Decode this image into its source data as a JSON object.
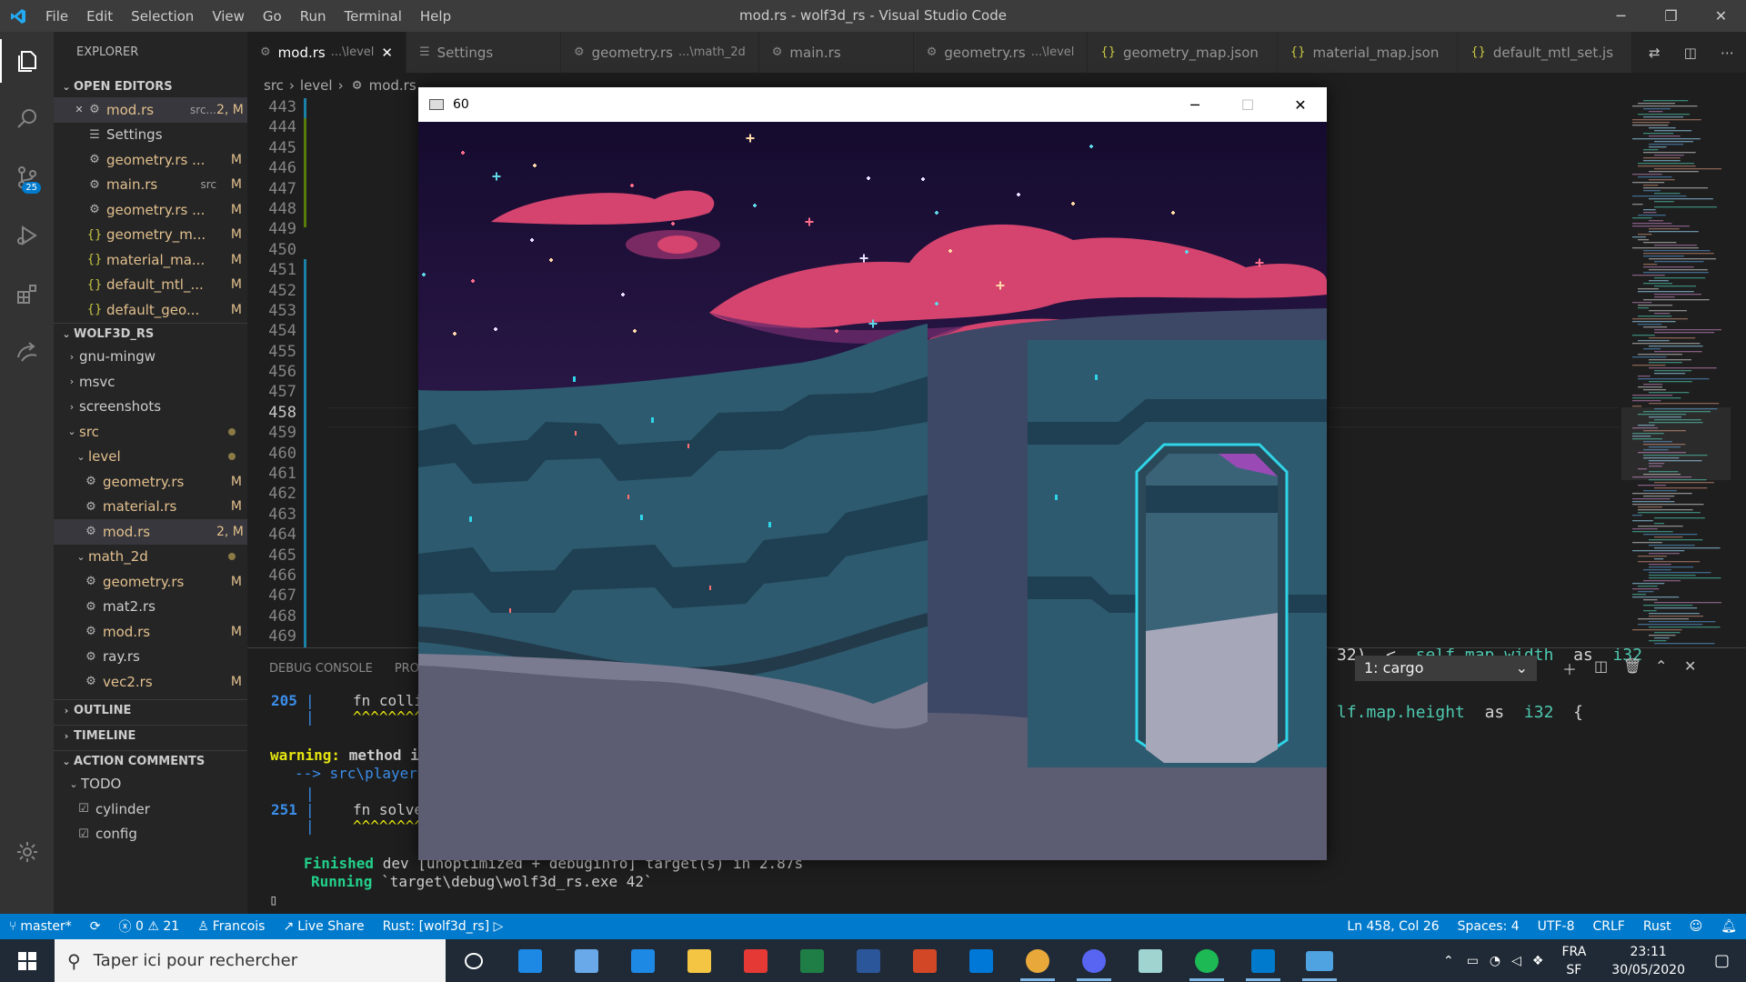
{
  "window": {
    "title": "mod.rs - wolf3d_rs - Visual Studio Code",
    "menu": [
      "File",
      "Edit",
      "Selection",
      "View",
      "Go",
      "Run",
      "Terminal",
      "Help"
    ],
    "controls": [
      "minimize",
      "restore",
      "close"
    ]
  },
  "activity_bar": {
    "items": [
      "explorer",
      "search",
      "source-control",
      "run-debug",
      "extensions",
      "live-share",
      "manage"
    ],
    "scm_badge": "25"
  },
  "sidebar": {
    "title": "EXPLORER",
    "open_editors_label": "OPEN EDITORS",
    "open_editors": [
      {
        "name": "mod.rs",
        "desc": "src...",
        "status": "2, M",
        "icon": "rust-icon"
      },
      {
        "name": "Settings",
        "desc": "",
        "status": "",
        "icon": "settings-list-icon"
      },
      {
        "name": "geometry.rs ...",
        "desc": "",
        "status": "M",
        "icon": "rust-icon"
      },
      {
        "name": "main.rs",
        "desc": "src",
        "status": "M",
        "icon": "rust-icon"
      },
      {
        "name": "geometry.rs ...",
        "desc": "",
        "status": "M",
        "icon": "rust-icon"
      },
      {
        "name": "geometry_m...",
        "desc": "",
        "status": "M",
        "icon": "json-icon"
      },
      {
        "name": "material_ma...",
        "desc": "",
        "status": "M",
        "icon": "json-icon"
      },
      {
        "name": "default_mtl_...",
        "desc": "",
        "status": "M",
        "icon": "json-icon"
      },
      {
        "name": "default_geo...",
        "desc": "",
        "status": "M",
        "icon": "json-icon"
      }
    ],
    "project_label": "WOLF3D_RS",
    "tree": [
      {
        "name": "gnu-mingw",
        "indent": 1,
        "type": "folder-closed",
        "status": "",
        "mod": false
      },
      {
        "name": "msvc",
        "indent": 1,
        "type": "folder-closed",
        "status": "",
        "mod": false
      },
      {
        "name": "screenshots",
        "indent": 1,
        "type": "folder-closed",
        "status": "",
        "mod": false
      },
      {
        "name": "src",
        "indent": 1,
        "type": "folder-open",
        "status": "dot",
        "mod": true
      },
      {
        "name": "level",
        "indent": 2,
        "type": "folder-open",
        "status": "dot",
        "mod": true
      },
      {
        "name": "geometry.rs",
        "indent": 3,
        "type": "file",
        "status": "M",
        "mod": true
      },
      {
        "name": "material.rs",
        "indent": 3,
        "type": "file",
        "status": "M",
        "mod": true
      },
      {
        "name": "mod.rs",
        "indent": 3,
        "type": "file",
        "status": "2, M",
        "mod": true
      },
      {
        "name": "math_2d",
        "indent": 2,
        "type": "folder-open",
        "status": "dot",
        "mod": true
      },
      {
        "name": "geometry.rs",
        "indent": 3,
        "type": "file",
        "status": "M",
        "mod": true
      },
      {
        "name": "mat2.rs",
        "indent": 3,
        "type": "file",
        "status": "",
        "mod": false
      },
      {
        "name": "mod.rs",
        "indent": 3,
        "type": "file",
        "status": "M",
        "mod": true
      },
      {
        "name": "ray.rs",
        "indent": 3,
        "type": "file",
        "status": "",
        "mod": false
      },
      {
        "name": "vec2.rs",
        "indent": 3,
        "type": "file",
        "status": "M",
        "mod": true
      }
    ],
    "outline_label": "OUTLINE",
    "timeline_label": "TIMELINE",
    "action_comments_label": "ACTION COMMENTS",
    "todo_label": "TODO",
    "todo_items": [
      "cylinder",
      "config"
    ]
  },
  "tabs": [
    {
      "label": "mod.rs",
      "desc": "...\\level",
      "active": true,
      "icon": "rust-icon"
    },
    {
      "label": "Settings",
      "desc": "",
      "active": false,
      "icon": "settings-list-icon"
    },
    {
      "label": "geometry.rs",
      "desc": "...\\math_2d",
      "active": false,
      "icon": "rust-icon"
    },
    {
      "label": "main.rs",
      "desc": "",
      "active": false,
      "icon": "rust-icon"
    },
    {
      "label": "geometry.rs",
      "desc": "...\\level",
      "active": false,
      "icon": "rust-icon"
    },
    {
      "label": "geometry_map.json",
      "desc": "",
      "active": false,
      "icon": "json-icon"
    },
    {
      "label": "material_map.json",
      "desc": "",
      "active": false,
      "icon": "json-icon"
    },
    {
      "label": "default_mtl_set.js",
      "desc": "",
      "active": false,
      "icon": "json-icon"
    }
  ],
  "breadcrumb": [
    "src",
    "level",
    "mod.rs"
  ],
  "editor": {
    "line_numbers": [
      "443",
      "444",
      "445",
      "446",
      "447",
      "448",
      "449",
      "450",
      "451",
      "452",
      "453",
      "454",
      "455",
      "456",
      "457",
      "458",
      "459",
      "460",
      "461",
      "462",
      "463",
      "464",
      "465",
      "466",
      "467",
      "468",
      "469"
    ],
    "visible_code_1_a": "32)  <  ",
    "visible_code_1_b": "self.map.width",
    "visible_code_1_c": "  as  ",
    "visible_code_1_d": "i32",
    "visible_code_2_a": "lf.map.height",
    "visible_code_2_b": "  as  ",
    "visible_code_2_c": "i32",
    "visible_code_2_d": "  {"
  },
  "panel": {
    "tabs": [
      "DEBUG CONSOLE",
      "PROB"
    ],
    "terminal_select": "1: cargo",
    "lines": {
      "l205_num": "205",
      "l205_code": "fn colli",
      "l205_caret": "^^^^^^^^",
      "warn_label": "warning:",
      "warn_text": " method is",
      "arrow": "--> src\\player.",
      "l251_num": "251",
      "l251_code": "fn solve",
      "l251_caret": "^^^^^^^^",
      "finished_label": "Finished",
      "finished_text": " dev [unoptimized + debuginfo] target(s) in 2.87s",
      "running_label": "Running",
      "running_text": " `target\\debug\\wolf3d_rs.exe 42`",
      "cursor": "▯"
    }
  },
  "statusbar": {
    "branch": "master*",
    "errors": "0",
    "warnings": "21",
    "user": "Francois",
    "live_share": "Live Share",
    "rust": "Rust: [wolf3d_rs]",
    "position": "Ln 458, Col 26",
    "spaces": "Spaces: 4",
    "encoding": "UTF-8",
    "eol": "CRLF",
    "language": "Rust"
  },
  "game_window": {
    "title": "60",
    "controls": [
      "minimize",
      "maximize",
      "close"
    ],
    "colors": {
      "sky_top": "#150b2e",
      "sky_bottom": "#4a2a6e",
      "cloud": "#d4446e",
      "wall": "#2d5a6e",
      "wall_dark": "#1f3f52",
      "floor": "#5c5c72",
      "floor_light": "#7a7a90",
      "accent": "#2fd5e8"
    }
  },
  "taskbar": {
    "search_placeholder": "Taper ici pour rechercher",
    "apps": [
      "task-view",
      "mail",
      "snip",
      "edge",
      "file-explorer",
      "gift",
      "excel",
      "word",
      "powerpoint",
      "store",
      "chrome",
      "discord",
      "notes",
      "spotify",
      "vscode",
      "game-window"
    ],
    "lang": "FRA",
    "lang_sub": "SF",
    "time": "23:11",
    "date": "30/05/2020"
  }
}
